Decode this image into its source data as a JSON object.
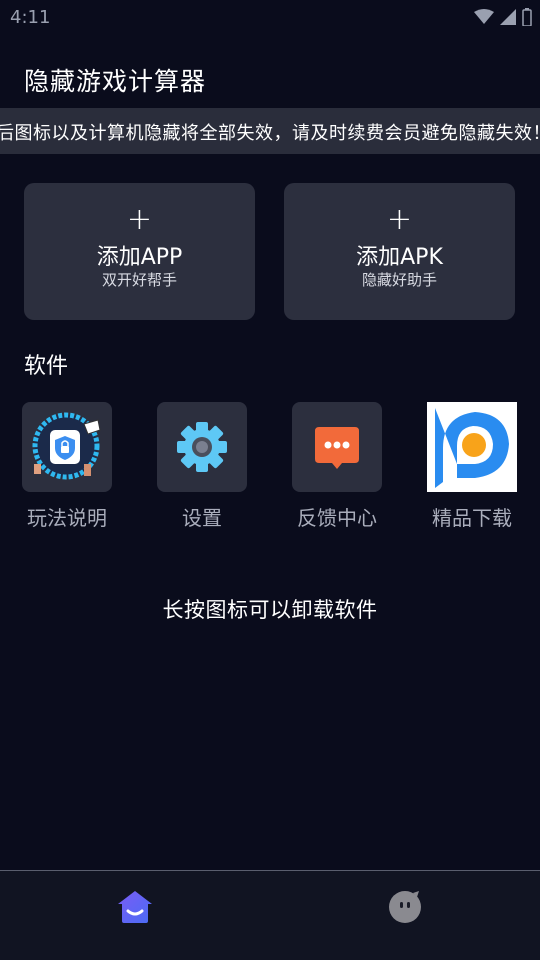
{
  "status_bar": {
    "time": "4:11"
  },
  "header": {
    "title": "隐藏游戏计算器"
  },
  "notice": {
    "text": "后图标以及计算机隐藏将全部失效，请及时续费会员避免隐藏失效！"
  },
  "cards": {
    "app": {
      "plus": "+",
      "title": "添加APP",
      "subtitle": "双开好帮手"
    },
    "apk": {
      "plus": "+",
      "title": "添加APK",
      "subtitle": "隐藏好助手"
    }
  },
  "software": {
    "title": "软件",
    "items": [
      {
        "label": "玩法说明",
        "icon": "guide-icon"
      },
      {
        "label": "设置",
        "icon": "gear-icon"
      },
      {
        "label": "反馈中心",
        "icon": "chat-icon"
      },
      {
        "label": "精品下载",
        "icon": "store-icon"
      }
    ]
  },
  "hint": "长按图标可以卸载软件",
  "bottom_nav": {
    "items": [
      {
        "name": "home",
        "icon": "home-icon",
        "active": true
      },
      {
        "name": "me",
        "icon": "face-icon",
        "active": false
      }
    ]
  },
  "colors": {
    "background": "#0a0c1c",
    "card": "#2c2f3e",
    "accent": "#5b5cf0",
    "chat_orange": "#f26a3a",
    "gear_blue": "#5ec8f5"
  }
}
